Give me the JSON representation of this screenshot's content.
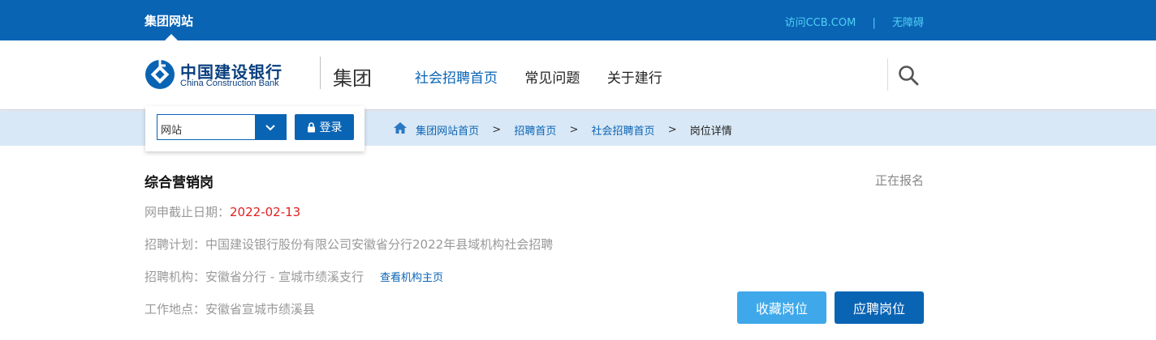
{
  "topbar": {
    "site_label": "集团网站",
    "visit_link": "访问CCB.COM",
    "separator": "|",
    "accessibility_link": "无障碍"
  },
  "header": {
    "logo_cn": "中国建设银行",
    "logo_en": "China Construction Bank",
    "group_label": "集团",
    "nav": [
      "社会招聘首页",
      "常见问题",
      "关于建行"
    ],
    "search_icon": "search-icon"
  },
  "panel": {
    "select_value": "网站",
    "login_label": "登录"
  },
  "breadcrumb": {
    "items": [
      "集团网站首页",
      "招聘首页",
      "社会招聘首页",
      "岗位详情"
    ],
    "separator": ">"
  },
  "job": {
    "title": "综合营销岗",
    "status": "正在报名",
    "deadline_label": "网申截止日期：",
    "deadline_value": "2022-02-13",
    "plan_label": "招聘计划：",
    "plan_value": "中国建设银行股份有限公司安徽省分行2022年县域机构社会招聘",
    "org_label": "招聘机构：",
    "org_value": "安徽省分行 - 宣城市绩溪支行",
    "org_link": "查看机构主页",
    "location_label": "工作地点：",
    "location_value": "安徽省宣城市绩溪县",
    "favorite_button": "收藏岗位",
    "apply_button": "应聘岗位"
  },
  "colors": {
    "primary": "#0a64b4",
    "light_blue": "#3fa8ea",
    "crumb_bg": "#d9e8f6",
    "deadline": "#e02020"
  }
}
